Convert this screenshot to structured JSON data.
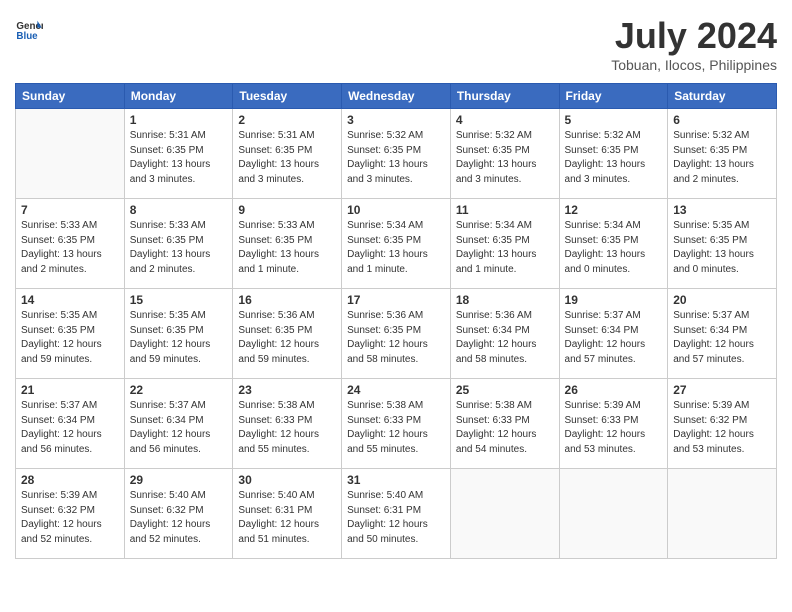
{
  "logo": {
    "text_general": "General",
    "text_blue": "Blue"
  },
  "title": {
    "month_year": "July 2024",
    "location": "Tobuan, Ilocos, Philippines"
  },
  "header": {
    "days": [
      "Sunday",
      "Monday",
      "Tuesday",
      "Wednesday",
      "Thursday",
      "Friday",
      "Saturday"
    ]
  },
  "weeks": [
    [
      {
        "day": "",
        "info": ""
      },
      {
        "day": "1",
        "info": "Sunrise: 5:31 AM\nSunset: 6:35 PM\nDaylight: 13 hours\nand 3 minutes."
      },
      {
        "day": "2",
        "info": "Sunrise: 5:31 AM\nSunset: 6:35 PM\nDaylight: 13 hours\nand 3 minutes."
      },
      {
        "day": "3",
        "info": "Sunrise: 5:32 AM\nSunset: 6:35 PM\nDaylight: 13 hours\nand 3 minutes."
      },
      {
        "day": "4",
        "info": "Sunrise: 5:32 AM\nSunset: 6:35 PM\nDaylight: 13 hours\nand 3 minutes."
      },
      {
        "day": "5",
        "info": "Sunrise: 5:32 AM\nSunset: 6:35 PM\nDaylight: 13 hours\nand 3 minutes."
      },
      {
        "day": "6",
        "info": "Sunrise: 5:32 AM\nSunset: 6:35 PM\nDaylight: 13 hours\nand 2 minutes."
      }
    ],
    [
      {
        "day": "7",
        "info": "Sunrise: 5:33 AM\nSunset: 6:35 PM\nDaylight: 13 hours\nand 2 minutes."
      },
      {
        "day": "8",
        "info": "Sunrise: 5:33 AM\nSunset: 6:35 PM\nDaylight: 13 hours\nand 2 minutes."
      },
      {
        "day": "9",
        "info": "Sunrise: 5:33 AM\nSunset: 6:35 PM\nDaylight: 13 hours\nand 1 minute."
      },
      {
        "day": "10",
        "info": "Sunrise: 5:34 AM\nSunset: 6:35 PM\nDaylight: 13 hours\nand 1 minute."
      },
      {
        "day": "11",
        "info": "Sunrise: 5:34 AM\nSunset: 6:35 PM\nDaylight: 13 hours\nand 1 minute."
      },
      {
        "day": "12",
        "info": "Sunrise: 5:34 AM\nSunset: 6:35 PM\nDaylight: 13 hours\nand 0 minutes."
      },
      {
        "day": "13",
        "info": "Sunrise: 5:35 AM\nSunset: 6:35 PM\nDaylight: 13 hours\nand 0 minutes."
      }
    ],
    [
      {
        "day": "14",
        "info": "Sunrise: 5:35 AM\nSunset: 6:35 PM\nDaylight: 12 hours\nand 59 minutes."
      },
      {
        "day": "15",
        "info": "Sunrise: 5:35 AM\nSunset: 6:35 PM\nDaylight: 12 hours\nand 59 minutes."
      },
      {
        "day": "16",
        "info": "Sunrise: 5:36 AM\nSunset: 6:35 PM\nDaylight: 12 hours\nand 59 minutes."
      },
      {
        "day": "17",
        "info": "Sunrise: 5:36 AM\nSunset: 6:35 PM\nDaylight: 12 hours\nand 58 minutes."
      },
      {
        "day": "18",
        "info": "Sunrise: 5:36 AM\nSunset: 6:34 PM\nDaylight: 12 hours\nand 58 minutes."
      },
      {
        "day": "19",
        "info": "Sunrise: 5:37 AM\nSunset: 6:34 PM\nDaylight: 12 hours\nand 57 minutes."
      },
      {
        "day": "20",
        "info": "Sunrise: 5:37 AM\nSunset: 6:34 PM\nDaylight: 12 hours\nand 57 minutes."
      }
    ],
    [
      {
        "day": "21",
        "info": "Sunrise: 5:37 AM\nSunset: 6:34 PM\nDaylight: 12 hours\nand 56 minutes."
      },
      {
        "day": "22",
        "info": "Sunrise: 5:37 AM\nSunset: 6:34 PM\nDaylight: 12 hours\nand 56 minutes."
      },
      {
        "day": "23",
        "info": "Sunrise: 5:38 AM\nSunset: 6:33 PM\nDaylight: 12 hours\nand 55 minutes."
      },
      {
        "day": "24",
        "info": "Sunrise: 5:38 AM\nSunset: 6:33 PM\nDaylight: 12 hours\nand 55 minutes."
      },
      {
        "day": "25",
        "info": "Sunrise: 5:38 AM\nSunset: 6:33 PM\nDaylight: 12 hours\nand 54 minutes."
      },
      {
        "day": "26",
        "info": "Sunrise: 5:39 AM\nSunset: 6:33 PM\nDaylight: 12 hours\nand 53 minutes."
      },
      {
        "day": "27",
        "info": "Sunrise: 5:39 AM\nSunset: 6:32 PM\nDaylight: 12 hours\nand 53 minutes."
      }
    ],
    [
      {
        "day": "28",
        "info": "Sunrise: 5:39 AM\nSunset: 6:32 PM\nDaylight: 12 hours\nand 52 minutes."
      },
      {
        "day": "29",
        "info": "Sunrise: 5:40 AM\nSunset: 6:32 PM\nDaylight: 12 hours\nand 52 minutes."
      },
      {
        "day": "30",
        "info": "Sunrise: 5:40 AM\nSunset: 6:31 PM\nDaylight: 12 hours\nand 51 minutes."
      },
      {
        "day": "31",
        "info": "Sunrise: 5:40 AM\nSunset: 6:31 PM\nDaylight: 12 hours\nand 50 minutes."
      },
      {
        "day": "",
        "info": ""
      },
      {
        "day": "",
        "info": ""
      },
      {
        "day": "",
        "info": ""
      }
    ]
  ]
}
